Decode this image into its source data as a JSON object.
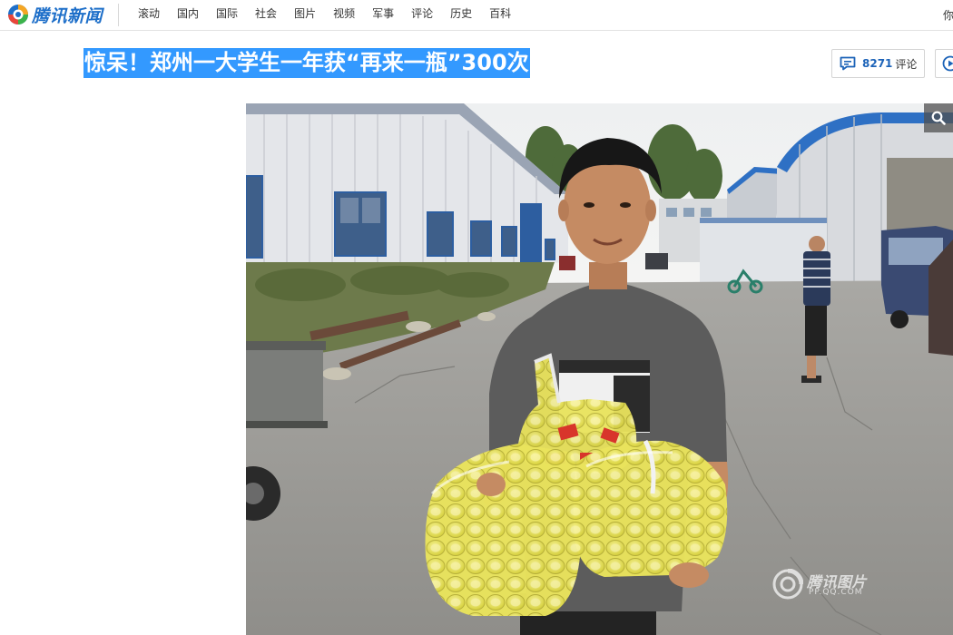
{
  "header": {
    "logo_text": "腾讯新闻",
    "nav": [
      "滚动",
      "国内",
      "国际",
      "社会",
      "图片",
      "视频",
      "军事",
      "评论",
      "历史",
      "百科"
    ],
    "user_text": "你"
  },
  "article": {
    "title": "惊呆！郑州一大学生一年获“再来一瓶”300次",
    "comment_count": "8271",
    "comment_label": "评论"
  },
  "photo": {
    "watermark_text": "腾讯图片",
    "watermark_sub": "PP.QQ.COM"
  },
  "colors": {
    "brand_blue": "#1e6fc9",
    "title_highlight": "#3399ff",
    "comment_count": "#1c63b8"
  },
  "icons": [
    "tencent-news-logo-icon",
    "comment-icon",
    "video-play-icon",
    "search-icon",
    "tencent-pics-watermark-icon"
  ]
}
